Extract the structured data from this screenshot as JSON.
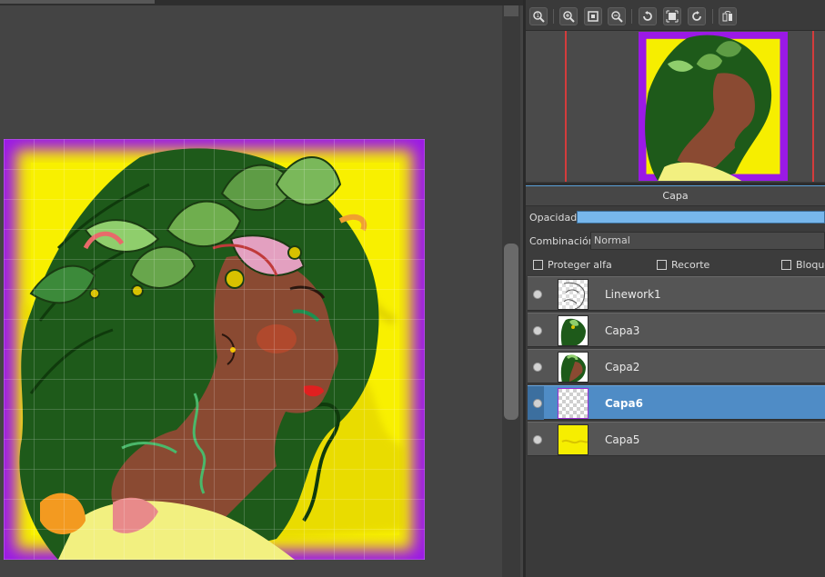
{
  "panel": {
    "title": "Capa",
    "opacity_label": "Opacidad",
    "opacity_value": 1.0,
    "blend_label": "Combinación",
    "blend_value": "Normal",
    "checkboxes": [
      {
        "label": "Proteger alfa",
        "checked": false
      },
      {
        "label": "Recorte",
        "checked": false
      },
      {
        "label": "Bloque",
        "checked": false
      }
    ]
  },
  "toolbar": {
    "icons": [
      "zoom-actual-icon",
      "zoom-in-icon",
      "fit-screen-icon",
      "zoom-out-icon",
      "rotate-left-icon",
      "fit-canvas-icon",
      "rotate-right-icon",
      "flip-icon"
    ]
  },
  "layers": [
    {
      "name": "Linework1",
      "visible": true,
      "selected": false,
      "thumb": "linework"
    },
    {
      "name": "Capa3",
      "visible": true,
      "selected": false,
      "thumb": "color"
    },
    {
      "name": "Capa2",
      "visible": true,
      "selected": false,
      "thumb": "color2"
    },
    {
      "name": "Capa6",
      "visible": true,
      "selected": true,
      "thumb": "transparent"
    },
    {
      "name": "Capa5",
      "visible": true,
      "selected": false,
      "thumb": "yellow"
    }
  ],
  "colors": {
    "background_yellow": "#f6ee00",
    "border_purple": "#9b19e6",
    "hair_green": "#1e5a1a",
    "skin": "#8a4a32",
    "selection_blue": "#4f8cc6",
    "opacity_bar": "#77b7ec"
  }
}
